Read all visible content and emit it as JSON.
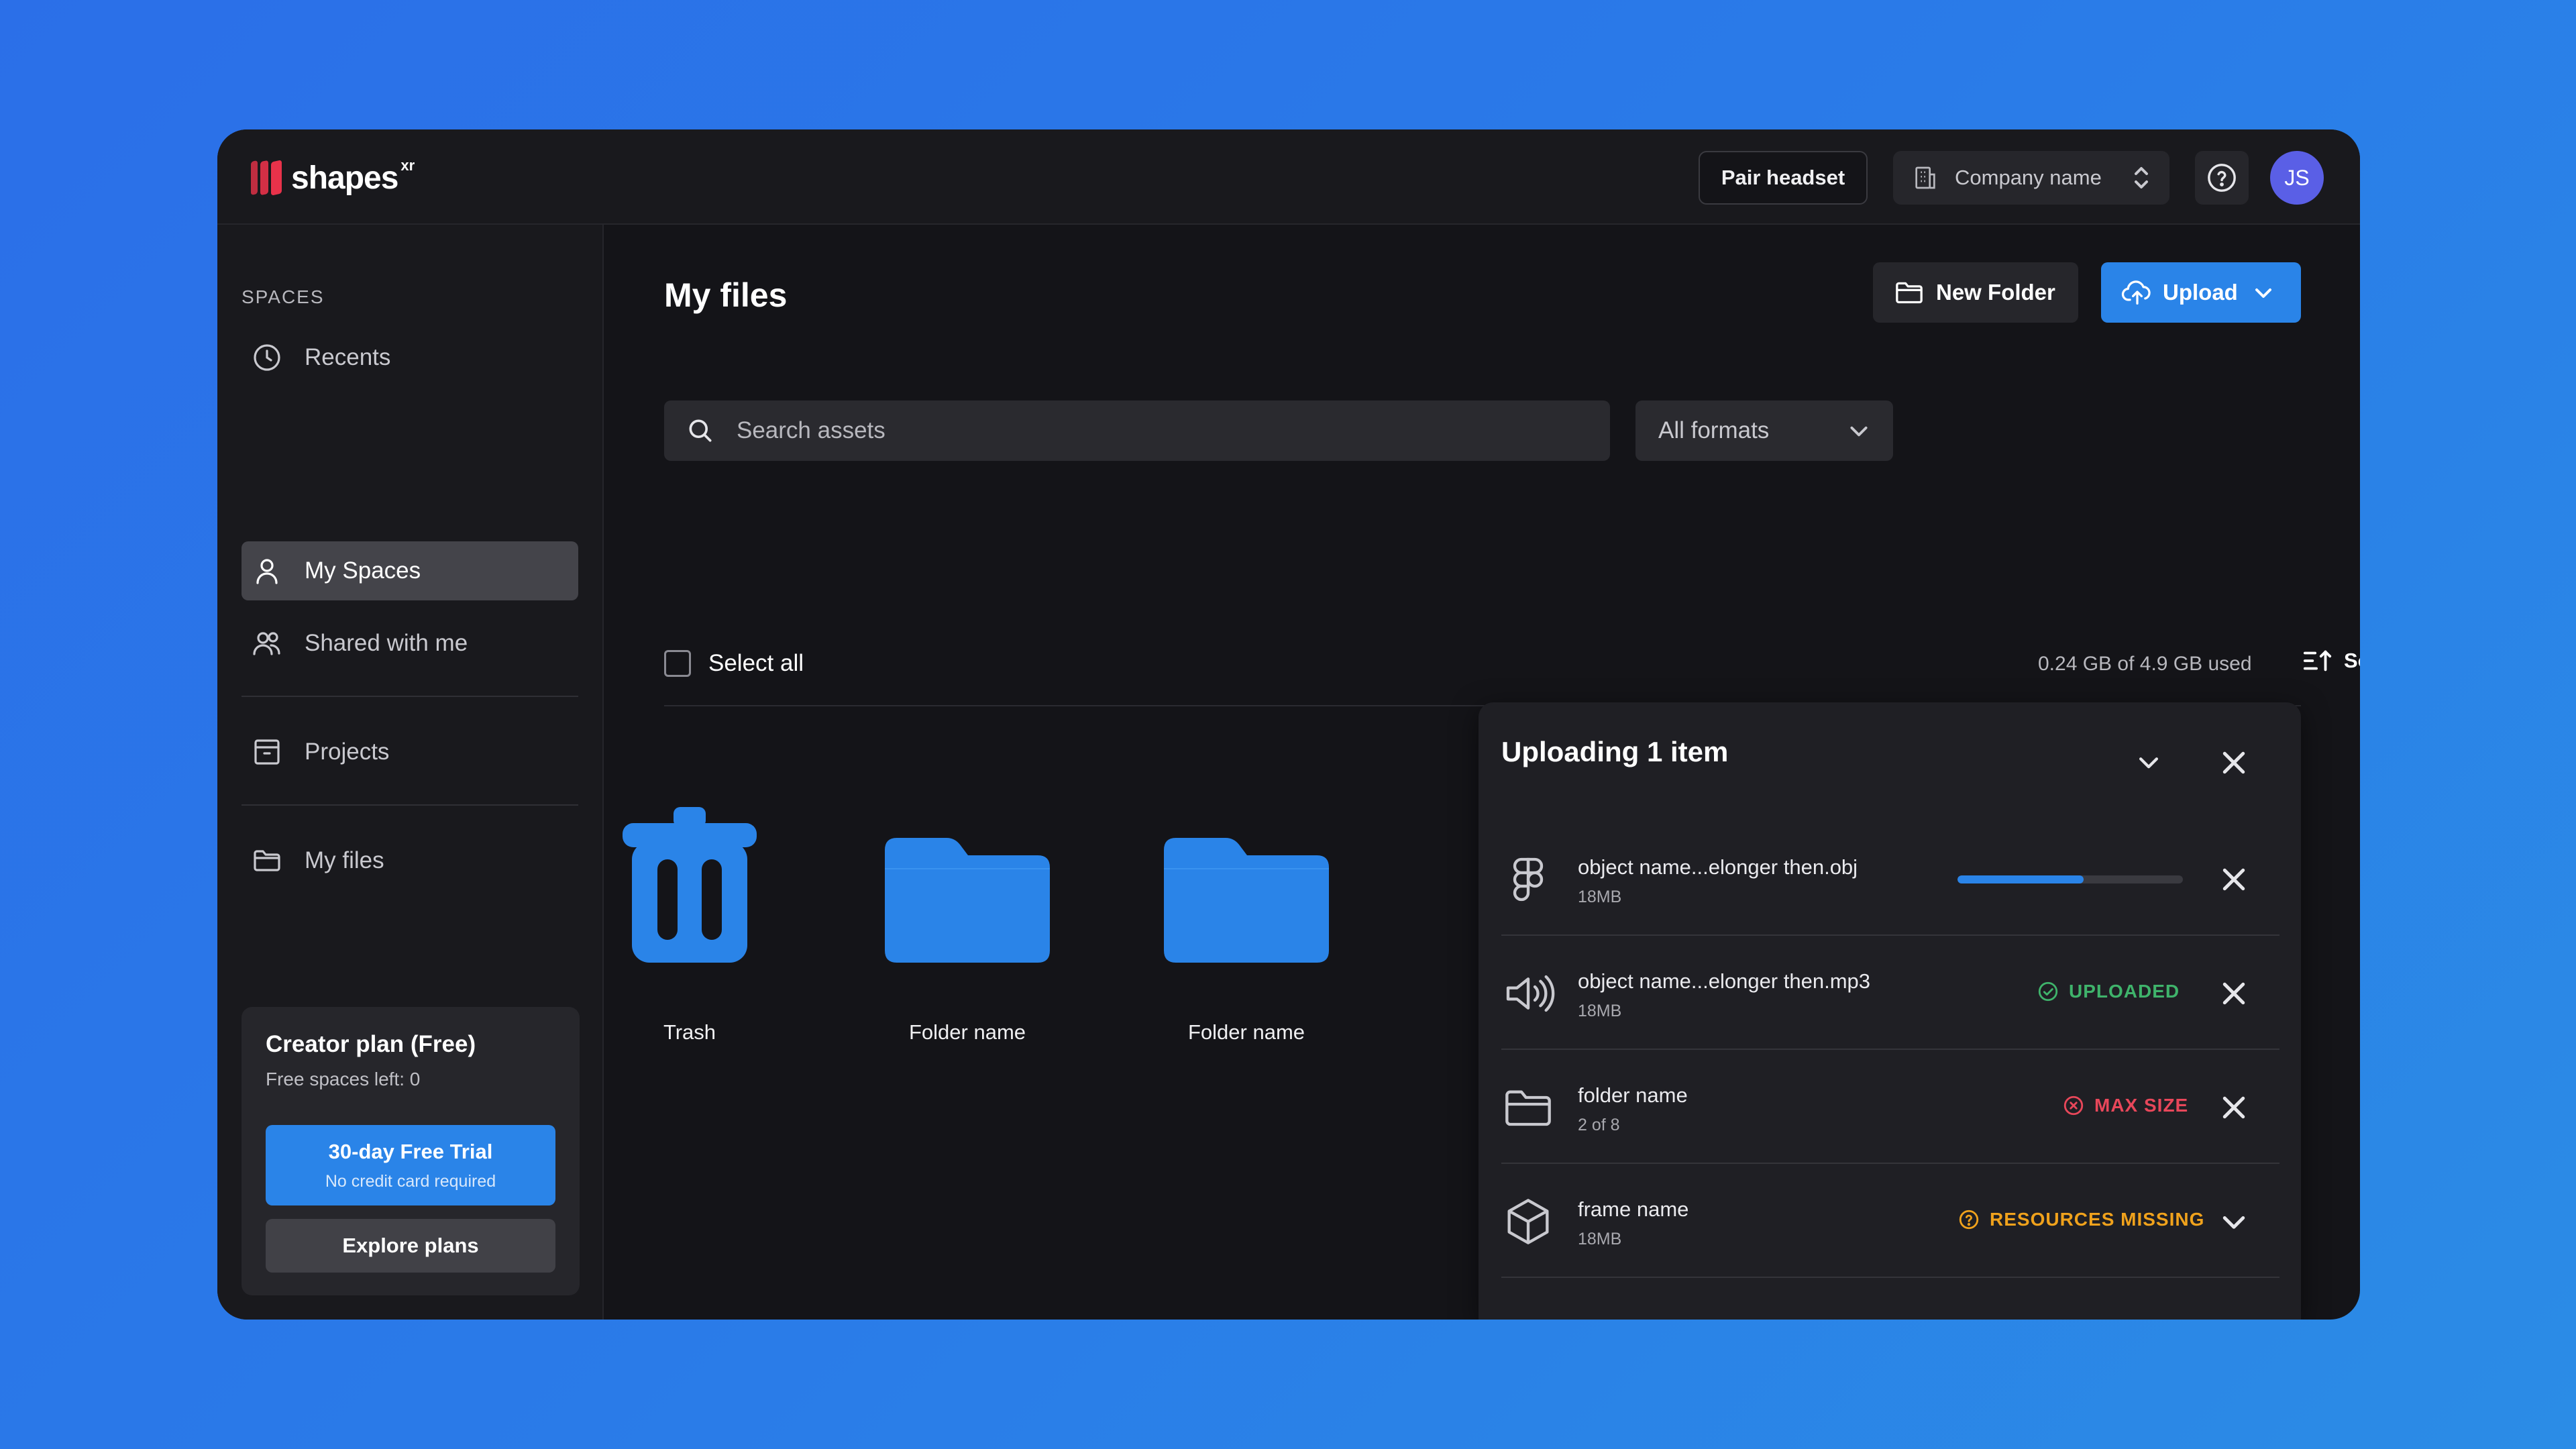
{
  "app": {
    "logo_text": "shapes",
    "logo_sup": "xr"
  },
  "header": {
    "pair_headset": "Pair headset",
    "company": "Company name",
    "avatar_initials": "JS"
  },
  "sidebar": {
    "section_label": "SPACES",
    "items": [
      {
        "label": "Recents",
        "icon": "clock-icon"
      },
      {
        "label": "My Spaces",
        "icon": "person-icon",
        "active": true
      },
      {
        "label": "Shared with me",
        "icon": "people-icon"
      },
      {
        "label": "Projects",
        "icon": "archive-icon"
      },
      {
        "label": "My files",
        "icon": "folder-icon"
      }
    ],
    "plan": {
      "title": "Creator plan (Free)",
      "subtitle": "Free spaces left: 0",
      "trial_label": "30-day Free Trial",
      "trial_note": "No credit card required",
      "explore_label": "Explore plans"
    }
  },
  "main": {
    "title": "My files",
    "new_folder": "New Folder",
    "upload": "Upload",
    "search_placeholder": "Search assets",
    "formats": "All formats",
    "select_all": "Select all",
    "storage": "0.24 GB of 4.9 GB used",
    "sort": "Sort",
    "tiles": [
      {
        "name": "Trash",
        "icon": "trash-icon"
      },
      {
        "name": "Folder name",
        "icon": "folder-icon"
      },
      {
        "name": "Folder name",
        "icon": "folder-icon"
      }
    ]
  },
  "upload_panel": {
    "title": "Uploading 1 item",
    "items": [
      {
        "name": "object name...elonger then.obj",
        "size": "18MB",
        "icon": "figma-icon",
        "progress": 0.56
      },
      {
        "name": "object name...elonger then.mp3",
        "size": "18MB",
        "icon": "speaker-icon",
        "status": "UPLOADED",
        "status_color": "#3fb36b"
      },
      {
        "name": "folder name",
        "size": "2 of 8",
        "icon": "folder-icon",
        "status": "MAX SIZE",
        "status_color": "#e8475a"
      },
      {
        "name": "frame name",
        "size": "18MB",
        "icon": "cube-icon",
        "status": "RESOURCES MISSING",
        "status_color": "#f0a21c"
      }
    ]
  },
  "colors": {
    "accent": "#2a84e8",
    "brand": "#e8324a",
    "success": "#3fb36b",
    "error": "#e8475a",
    "warning": "#f0a21c"
  }
}
